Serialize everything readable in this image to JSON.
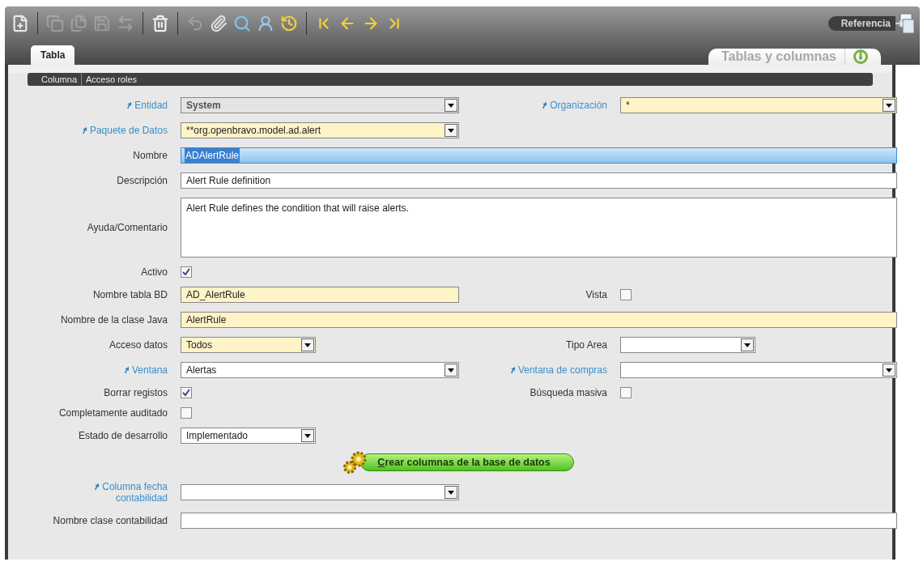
{
  "toolbar": [
    [
      {
        "disabled": false
      }
    ],
    [
      {
        "disabled": true
      },
      {
        "disabled": true
      },
      {
        "disabled": true
      },
      {
        "disabled": true
      }
    ],
    [
      {
        "disabled": false
      }
    ],
    [
      {
        "disabled": true
      },
      {
        "disabled": false
      },
      {
        "disabled": false
      },
      {
        "disabled": false
      },
      {
        "disabled": false
      }
    ],
    [
      {
        "disabled": false
      },
      {
        "disabled": false
      },
      {
        "disabled": false
      },
      {
        "disabled": false
      }
    ]
  ],
  "reference_button": "Referencia",
  "tabs": [
    {
      "label": "Tabla",
      "selected": true
    }
  ],
  "window": {
    "title": "Tablas y columnas"
  },
  "subtabs": [
    "Columna",
    "Acceso roles"
  ],
  "form": {
    "rows": [
      [
        {
          "label": "Entidad",
          "linked": true,
          "kind": "select",
          "value": "System",
          "disabled": true
        },
        {
          "label": "Organización",
          "linked": true,
          "kind": "select",
          "value": "*",
          "required": true
        }
      ],
      [
        {
          "label": "Paquete de Datos",
          "linked": true,
          "kind": "select",
          "value": "**org.openbravo.model.ad.alert",
          "required": true
        }
      ],
      [
        {
          "label": "Nombre",
          "linked": false,
          "kind": "text",
          "value": "ADAlertRule",
          "focused": true
        }
      ],
      [
        {
          "label": "Descripción",
          "linked": false,
          "kind": "text",
          "value": "Alert Rule definition",
          "required": false
        }
      ],
      [
        {
          "label": "Ayuda/Comentario",
          "linked": false,
          "kind": "textarea",
          "value": "Alert Rule defines the condition that will raise alerts.",
          "required": false
        }
      ],
      [
        {
          "label": "Activo",
          "linked": false,
          "kind": "checkbox",
          "checked": true
        }
      ],
      [
        {
          "label": "Nombre tabla BD",
          "linked": false,
          "kind": "text",
          "value": "AD_AlertRule",
          "required": true
        },
        {
          "label": "Vista",
          "linked": false,
          "kind": "checkbox",
          "checked": false
        }
      ],
      [
        {
          "label": "Nombre de la clase Java",
          "linked": false,
          "kind": "text",
          "value": "AlertRule",
          "required": true
        }
      ],
      [
        {
          "label": "Acceso datos",
          "linked": false,
          "kind": "select",
          "short": true,
          "value": "Todos",
          "required": true
        },
        {
          "label": "Tipo Area",
          "linked": false,
          "kind": "select",
          "short": true,
          "required": false
        }
      ],
      [
        {
          "label": "Ventana",
          "linked": true,
          "kind": "select",
          "value": "Alertas",
          "required": false
        },
        {
          "label": "Ventana de compras",
          "linked": true,
          "kind": "select",
          "required": false
        }
      ],
      [
        {
          "label": "Borrar registos",
          "linked": false,
          "kind": "checkbox",
          "checked": true
        },
        {
          "label": "Búsqueda masiva",
          "linked": false,
          "kind": "checkbox",
          "checked": false
        }
      ],
      [
        {
          "label": "Completamente auditado",
          "linked": false,
          "kind": "checkbox",
          "checked": false
        }
      ],
      [
        {
          "label": "Estado de desarrollo",
          "linked": false,
          "kind": "select",
          "short": true,
          "value": "Implementado",
          "required": false
        }
      ]
    ],
    "action_button": "Crear columnas de la base de datos",
    "rows_after": [
      [
        {
          "label": "Columna fecha contabilidad",
          "linked": true,
          "kind": "select",
          "required": false
        }
      ],
      [
        {
          "label": "Nombre clase contabilidad",
          "linked": false,
          "kind": "text",
          "required": false
        }
      ]
    ]
  }
}
